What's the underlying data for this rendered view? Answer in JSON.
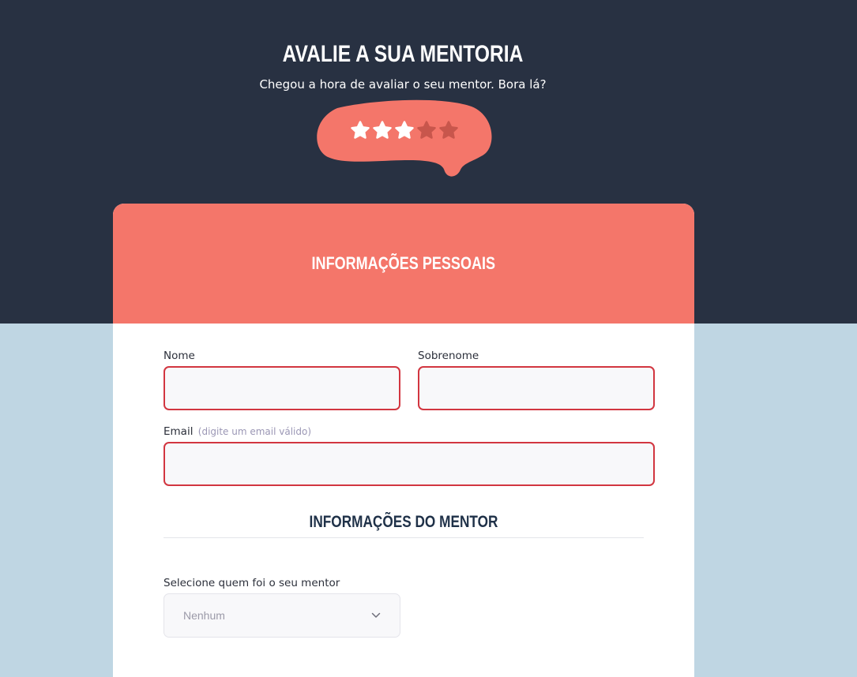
{
  "header": {
    "title": "AVALIE A SUA MENTORIA",
    "subtitle": "Chegou a hora de avaliar o seu mentor. Bora lá?"
  },
  "rating": {
    "value": 3,
    "max": 5,
    "colors": {
      "bubble": "#f4766a",
      "filled": "#ffffff",
      "empty": "#c8564c"
    }
  },
  "personal_section": {
    "title": "INFORMAÇÕES PESSOAIS",
    "first_name": {
      "label": "Nome",
      "value": ""
    },
    "last_name": {
      "label": "Sobrenome",
      "value": ""
    },
    "email": {
      "label": "Email",
      "hint": "(digite um email válido)",
      "value": ""
    }
  },
  "mentor_section": {
    "title": "INFORMAÇÕES DO MENTOR",
    "select_label": "Selecione quem foi o seu mentor",
    "selected": "Nenhum"
  },
  "colors": {
    "dark_bg": "#283142",
    "light_bg": "#bfd6e3",
    "accent": "#f4766a",
    "error_border": "#d23640"
  }
}
